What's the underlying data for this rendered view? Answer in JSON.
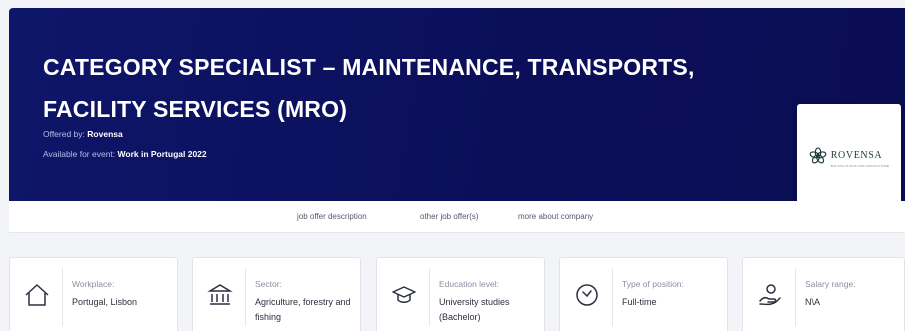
{
  "job": {
    "title": "CATEGORY SPECIALIST – MAINTENANCE, TRANSPORTS, FACILITY SERVICES (MRO)",
    "offered_by_label": "Offered by:",
    "offered_by": "Rovensa",
    "event_label": "Available for event:",
    "event": "Work in Portugal 2022"
  },
  "company_logo": {
    "name": "ROVENSA",
    "tagline": "BIO-SOLUTIONS FOR AGRICULTURE"
  },
  "tabs": [
    {
      "label": "job offer description"
    },
    {
      "label": "other job offer(s)"
    },
    {
      "label": "more about company"
    }
  ],
  "details": [
    {
      "label": "Workplace:",
      "value": "Portugal, Lisbon",
      "icon": "home-icon"
    },
    {
      "label": "Sector:",
      "value": "Agriculture, forestry and fishing",
      "icon": "institution-icon"
    },
    {
      "label": "Education level:",
      "value": "University studies (Bachelor)",
      "icon": "graduation-cap-icon"
    },
    {
      "label": "Type of position:",
      "value": "Full-time",
      "icon": "clock-icon"
    },
    {
      "label": "Salary range:",
      "value": "N\\A",
      "icon": "salary-hand-icon"
    }
  ],
  "colors": {
    "hero_bg": "#0e1669",
    "page_bg": "#f3f4f7",
    "logo_green": "#1d3b38"
  }
}
